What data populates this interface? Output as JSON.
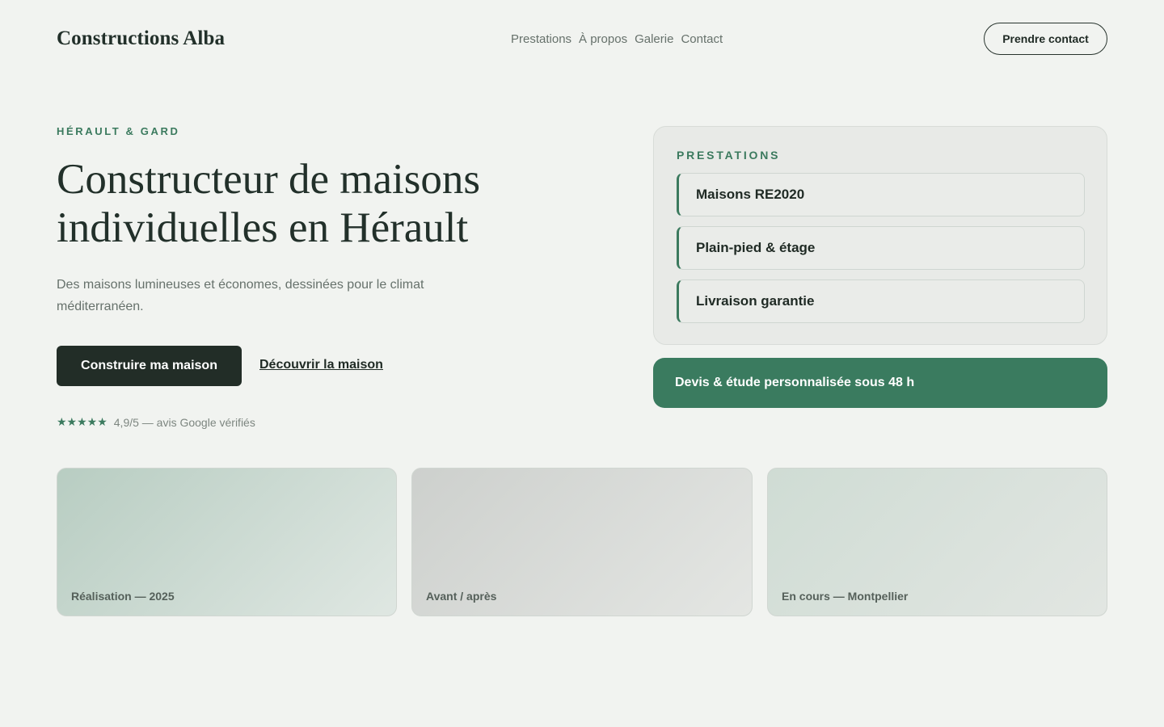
{
  "header": {
    "brand": "Constructions Alba",
    "nav": [
      "Prestations",
      "À propos",
      "Galerie",
      "Contact"
    ],
    "cta": "Prendre contact"
  },
  "hero": {
    "eyebrow": "HÉRAULT & GARD",
    "title": "Constructeur de maisons individuelles en Hérault",
    "subtitle": "Des maisons lumineuses et économes, dessinées pour le climat méditerranéen.",
    "primary_button": "Construire ma maison",
    "secondary_link": "Découvrir la maison",
    "stars": "★★★★★",
    "rating_text": "4,9/5 — avis Google vérifiés"
  },
  "services": {
    "title": "PRESTATIONS",
    "items": [
      "Maisons RE2020",
      "Plain-pied & étage",
      "Livraison garantie"
    ]
  },
  "quote_banner": "Devis & étude personnalisée sous 48 h",
  "gallery": [
    {
      "label": "Réalisation — 2025"
    },
    {
      "label": "Avant / après"
    },
    {
      "label": "En cours — Montpellier"
    }
  ],
  "colors": {
    "background": "#f1f3f0",
    "accent": "#3a7b5f",
    "dark": "#222d27"
  }
}
